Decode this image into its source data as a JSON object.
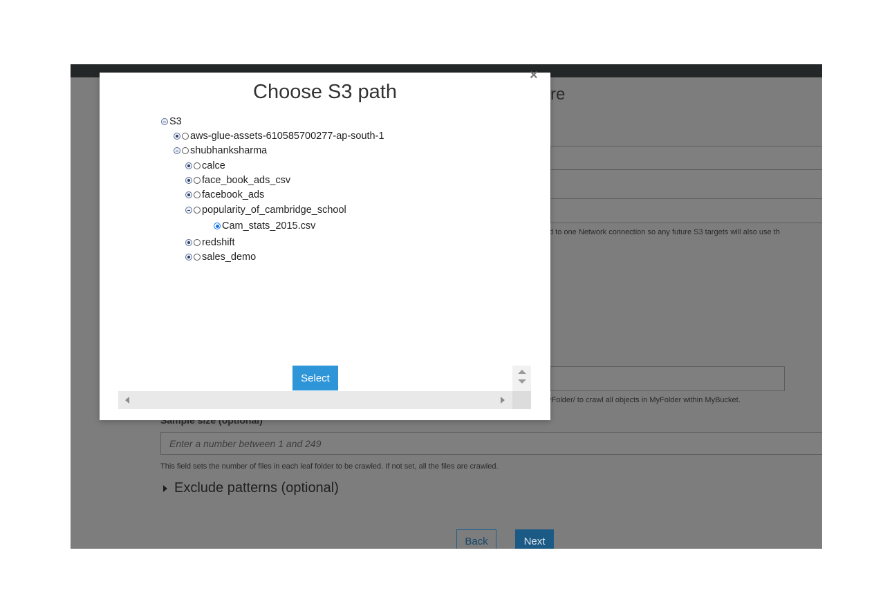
{
  "background": {
    "heading_fragment": "re",
    "network_note": "d to one Network connection so any future S3 targets will also use th",
    "path_hint": "yFolder/ to crawl all objects in MyFolder within MyBucket.",
    "sample_size_label": "Sample size (optional)",
    "sample_size_placeholder": "Enter a number between 1 and 249",
    "sample_size_help": "This field sets the number of files in each leaf folder to be crawled. If not set, all the files are crawled.",
    "exclude_patterns": "Exclude patterns (optional)",
    "back_label": "Back",
    "next_label": "Next"
  },
  "modal": {
    "title": "Choose S3 path",
    "close_glyph": "×",
    "select_label": "Select",
    "tree": [
      {
        "label": "S3",
        "toggle": "minus",
        "radio": false
      },
      {
        "label": "aws-glue-assets-610585700277-ap-south-1",
        "toggle": "plus",
        "radio": true,
        "checked": false
      },
      {
        "label": "shubhanksharma",
        "toggle": "minus",
        "radio": true,
        "checked": false
      },
      {
        "label": "calce",
        "toggle": "plus",
        "radio": true,
        "checked": false
      },
      {
        "label": "face_book_ads_csv",
        "toggle": "plus",
        "radio": true,
        "checked": false
      },
      {
        "label": "facebook_ads",
        "toggle": "plus",
        "radio": true,
        "checked": false
      },
      {
        "label": "popularity_of_cambridge_school",
        "toggle": "minus",
        "radio": true,
        "checked": false
      },
      {
        "label": "Cam_stats_2015.csv",
        "toggle": "none",
        "radio": true,
        "checked": true
      },
      {
        "label": "redshift",
        "toggle": "plus",
        "radio": true,
        "checked": false
      },
      {
        "label": "sales_demo",
        "toggle": "plus",
        "radio": true,
        "checked": false
      }
    ]
  },
  "colors": {
    "select_button": "#2d95d8",
    "next_button": "#1b5a85",
    "overlay": "#7d7d7d",
    "topbar": "#232727"
  }
}
